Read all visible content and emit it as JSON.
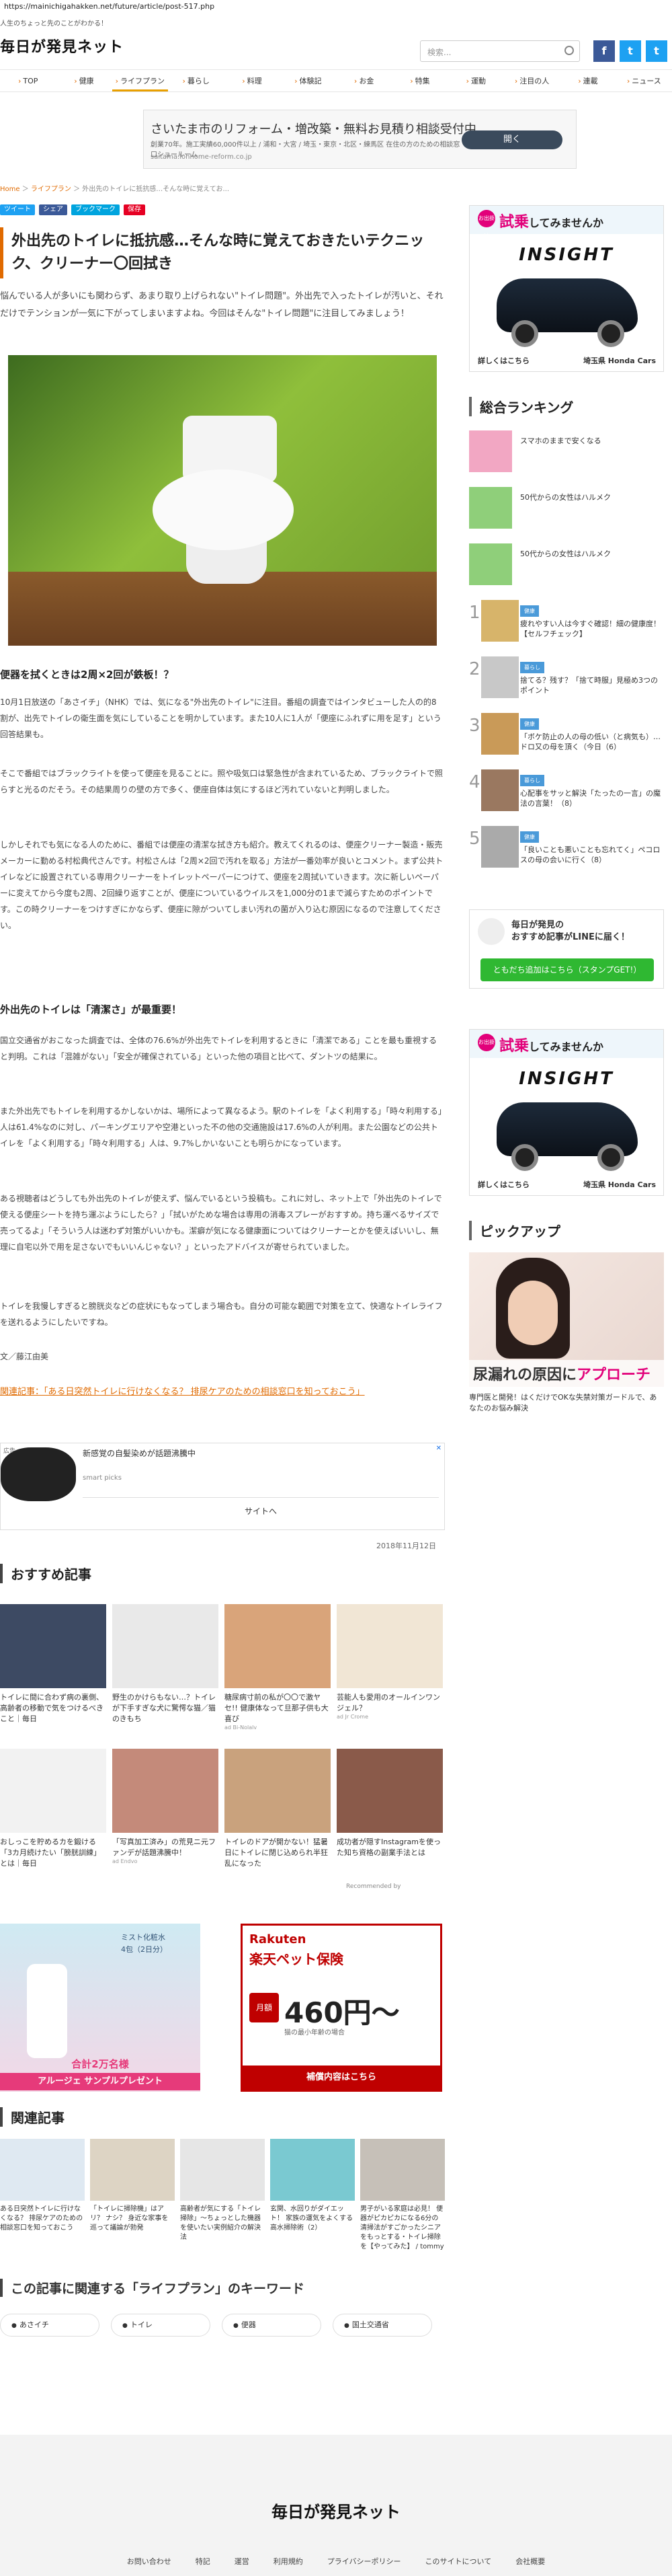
{
  "browser": {
    "url": "https://mainichigahakken.net/future/article/post-517.php"
  },
  "site": {
    "tagline": "人生のちょっと先のことがわかる！",
    "logo": "毎日が発見ネット",
    "search_placeholder": "検索..."
  },
  "social": {
    "facebook": "f",
    "twitter": "t",
    "other": "t"
  },
  "nav": [
    {
      "label": "TOP"
    },
    {
      "label": "健康"
    },
    {
      "label": "ライフプラン"
    },
    {
      "label": "暮らし"
    },
    {
      "label": "料理"
    },
    {
      "label": "体験記"
    },
    {
      "label": "お金"
    },
    {
      "label": "特集"
    },
    {
      "label": "運動"
    },
    {
      "label": "注目の人"
    },
    {
      "label": "連載"
    },
    {
      "label": "ニュース"
    }
  ],
  "top_ad": {
    "title": "さいたま市のリフォーム・増改築・無料お見積り相談受付中",
    "sub": "創業70年。施工実績60,000件以上 / 浦和・大宮 / 埼玉・東京・北区・練馬区 在住の方のための相談窓口ショールーム",
    "url": "saitama.lohhome-reform.co.jp",
    "button": "開く"
  },
  "breadcrumb": {
    "home": "Home",
    "sep1": "＞",
    "cat": "ライフプラン",
    "sep2": "＞",
    "current": "外出先のトイレに抵抗感…そんな時に覚えてお..."
  },
  "share": [
    {
      "label": "ツイート",
      "color": "#1da1f2"
    },
    {
      "label": "シェア",
      "color": "#3b5998"
    },
    {
      "label": "ブックマーク",
      "color": "#00a4de"
    },
    {
      "label": "保存",
      "color": "#e60023"
    }
  ],
  "article": {
    "title": "外出先のトイレに抵抗感…そんな時に覚えておきたいテクニック、クリーナー〇回拭き",
    "lead": "悩んでいる人が多いにも関わらず、あまり取り上げられない\"トイレ問題\"。外出先で入ったトイレが汚いと、それだけでテンションが一気に下がってしまいますよね。今回はそんな\"トイレ問題\"に注目してみましょう！",
    "h1": "便器を拭くときは2周×2回が鉄板！？",
    "p1": "10月1日放送の「あさイチ」（NHK）では、気になる\"外出先のトイレ\"に注目。番組の調査ではインタビューした人の的8割が、出先でトイレの衛生面を気にしていることを明かしています。また10人に1人が「便座にふれずに用を足す」という回答結果も。",
    "p2": "そこで番組ではブラックライトを使って便座を見ることに。照や吸気口は緊急性が含まれているため、ブラックライトで照らすと光るのだそう。その結果周りの壁の方で多く、便座自体は気にするほど汚れていないと判明しました。",
    "p3": "しかしそれでも気になる人のために、番組では便座の清潔な拭き方も紹介。教えてくれるのは、便座クリーナー製造・販売メーカーに勤める村松典代さんです。村松さんは「2周×2回で汚れを取る」方法が一番効率が良いとコメント。まず公共トイレなどに設置されている専用クリーナーをトイレットペーパーにつけて、便座を2周拭いていきます。次に新しいペーパーに変えてから今度も2周、2回繰り返すことが、便座についているウイルスを1,000分の1まで減らすためのポイントです。この時クリーナーをつけすぎにかならず、便座に隙がついてしまい汚れの菌が入り込む原因になるので注意してください。",
    "h2": "外出先のトイレは「清潔さ」が最重要！",
    "p4": "国立交通省がおこなった調査では、全体の76.6%が外出先でトイレを利用するときに「清潔である」ことを最も重視すると判明。これは「混雑がない」「安全が確保されている」といった他の項目と比べて、ダントツの結果に。",
    "p5": "また外出先でもトイレを利用するかしないかは、場所によって異なるよう。駅のトイレを「よく利用する」「時々利用する」人は61.4%なのに対し、パーキングエリアや空港といった不の他の交通施設は17.6%の人が利用。また公園などの公共トイレを「よく利用する」「時々利用する」人は、9.7%しかいないことも明らかになっています。",
    "p6": "ある視聴者はどうしても外出先のトイレが使えず、悩んでいるという投稿も。これに対し、ネット上で「外出先のトイレで使える便座シートを持ち運ぶようにしたら？」「拭いがためな場合は専用の消毒スプレーがおすすめ。持ち運べるサイズで売ってるよ」「そういう人は迷わず対策がいいかも。潔癖が気になる健康面についてはクリーナーとかを使えばいいし、無理に自宅以外で用を足さないでもいいんじゃない？」といったアドバイスが寄せられていました。",
    "p7": "トイレを我慢しすぎると膀胱炎などの症状にもなってしまう場合も。自分の可能な範囲で対策を立て、快適なトイレライフを送れるようにしたいですね。",
    "author": "文／藤江由美",
    "related_link": "関連記事：「ある日突然トイレに行けなくなる？ 排尿ケアのための相談窓口を知っておこう」"
  },
  "inline_ad": {
    "label": "広告",
    "title": "新感覚の自髪染めが話題沸騰中",
    "source": "smart picks",
    "button": "サイトへ"
  },
  "publish_date": "2018年11月12日",
  "recommend": {
    "title": "おすすめ記事",
    "items": [
      {
        "text": "トイレに間に合わず病の裏側、高齢者の移動で気をつけるべきこと｜毎日",
        "src": "",
        "color": "#3d4a63"
      },
      {
        "text": "野生のかけらもない…？トイレが下手すぎな犬に驚愕な猫／猫のきもち",
        "src": "",
        "color": "#e9e9e9"
      },
      {
        "text": "糖尿病寸前の私が〇〇で激ヤセ!! 健康体なって旦那子供も大喜び",
        "src": "ad Bi-Nolalv",
        "color": "#d9a47a"
      },
      {
        "text": "芸能人も愛用のオールインワンジェル？",
        "src": "ad Jr Crome",
        "color": "#f1e6d5"
      },
      {
        "text": "おしっこを貯めるカを鍛ける「3カ月続けたい「膀胱訓練」とは｜毎日",
        "src": "",
        "color": "#f2f2f2"
      },
      {
        "text": "「写真加工済み」の荒見ニ元ファンデが話題沸騰中！",
        "src": "ad Endvo",
        "color": "#c48a7a"
      },
      {
        "text": "トイレのドアが開かない！猛暑日にトイレに閉じ込められ半狂乱になった",
        "src": "",
        "color": "#c9a27d"
      },
      {
        "text": "成功者が隠すInstagramを使った知ち資格の副業手法とは",
        "src": "",
        "color": "#8a5a4a"
      }
    ],
    "recommended_by": "Recommended by"
  },
  "ads_pair": {
    "left": {
      "line1": "ミスト化粧水",
      "line2": "4包（2日分）",
      "line3": "合計2万名様",
      "line4": "アルージェ サンプルプレゼント"
    },
    "right": {
      "brand": "Rakuten",
      "name": "楽天ペット保険",
      "label": "月額",
      "price": "460円～",
      "note": "猫の最小年齢の場合",
      "cta": "補償内容はこちら"
    }
  },
  "related": {
    "title": "関連記事",
    "items": [
      {
        "text": "ある日突然トイレに行けなくなる？ 排尿ケアのための相談窓口を知っておこう",
        "color": "#dfe9f2"
      },
      {
        "text": "「トイレに掃除機」はアリ？ ナシ？ 身近な家事を巡って議論が勃発",
        "color": "#ddd4c4"
      },
      {
        "text": "高齢者が気にする「トイレ掃除」～ちょっとした機器を使いたい実例紹介の解決法",
        "color": "#e6e6e6"
      },
      {
        "text": "玄関、水回りがダイエット！ 家族の運気をよくする高水掃除術（2）",
        "color": "#7ac9d1"
      },
      {
        "text": "男子がいる家庭は必見！ 便器がピカピカになる6分の清掃法がすごかったシニアをもっとする・トイレ掃除を【やってみた】 / tommy",
        "color": "#c6c0b8"
      }
    ]
  },
  "keywords": {
    "title": "この記事に関連する「ライフプラン」のキーワード",
    "items": [
      "あさイチ",
      "トイレ",
      "便器",
      "国土交通省"
    ]
  },
  "footer": {
    "logo": "毎日が発見ネット",
    "links": [
      "お問い合わせ",
      "特記",
      "運営",
      "利用規約",
      "プライバシーポリシー",
      "このサイトについて",
      "会社概要"
    ]
  },
  "sidebar": {
    "car_ad": {
      "badge": "お出掛け",
      "t1": "試乗",
      "t2": "してみませんか",
      "model": "INSIGHT",
      "foot_left": "詳しくはこちら",
      "foot_right": "埼玉県 Honda Cars"
    },
    "ranking_title": "総合ランキング",
    "ranking": [
      {
        "num": "",
        "tag": "",
        "text": "スマホのままで安くなる",
        "color": "#f2a7c3"
      },
      {
        "num": "",
        "tag": "",
        "text": "50代からの女性はハルメク",
        "color": "#8fcf7a"
      },
      {
        "num": "",
        "tag": "",
        "text": "50代からの女性はハルメク",
        "color": "#8fcf7a"
      },
      {
        "num": "1",
        "tag": "健康",
        "text": "疲れやすい人は今すぐ確認！細の健康度！【セルフチェック】",
        "color": "#d7b46a"
      },
      {
        "num": "2",
        "tag": "暮らし",
        "text": "捨てる？残す？「捨て時服」見極め3つのポイント",
        "color": "#c8c8c8"
      },
      {
        "num": "3",
        "tag": "健康",
        "text": "「ボケ防止の人の母の低い（と病気も）…ドロ又の母を頂く（今日（6）",
        "color": "#c99a58"
      },
      {
        "num": "4",
        "tag": "暮らし",
        "text": "心配事をサッと解決「たったの一言」の魔法の言葉！（8）",
        "color": "#9a7860"
      },
      {
        "num": "5",
        "tag": "健康",
        "text": "「良いことも悪いことも忘れてく」ペコロスの母の会いに行く（8）",
        "color": "#aaaaaa"
      }
    ],
    "line": {
      "title": "毎日が発見の\nおすすめ記事がLINEに届く！",
      "button": "ともだち追加はこちら（スタンプGET!）"
    },
    "pickup_title": "ピックアップ",
    "pickup": {
      "caption1": "尿漏れの原因に",
      "caption2": "アプローチ",
      "text": "専門医と開発！はくだけでOKな失禁対策ガードルで、あなたのお悩み解決"
    }
  }
}
